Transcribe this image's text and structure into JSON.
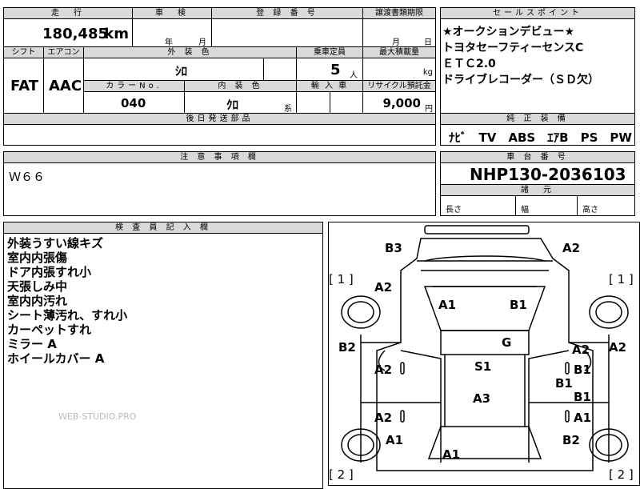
{
  "header": {
    "mileage_label": "走　行",
    "inspection_label": "車　検",
    "registration_label": "登 録 番 号",
    "transfer_label": "譲渡書類期限",
    "sale_points_label": "セールスポイント",
    "mileage_value": "180,485",
    "mileage_unit": "km",
    "year_unit": "年",
    "month_unit": "月",
    "transfer_month": "月",
    "transfer_day": "日"
  },
  "specs": {
    "shift_label": "シフト",
    "aircon_label": "エアコン",
    "exterior_label": "外 装 色",
    "capacity_label": "乗車定員",
    "max_load_label": "最大積載量",
    "shift_value": "FAT",
    "aircon_value": "AAC",
    "exterior_value": "ｼﾛ",
    "capacity_value": "5",
    "capacity_unit": "人",
    "load_unit": "kg",
    "color_no_label": "カラーNo.",
    "interior_label": "内 装 色",
    "import_label": "輸 入 車",
    "recycle_label": "リサイクル預託金",
    "color_no_value": "040",
    "interior_value": "ｸﾛ",
    "interior_suffix": "系",
    "recycle_value": "9,000",
    "recycle_unit": "円",
    "later_parts_label": "後日発送部品"
  },
  "sale_points": {
    "lines": [
      "★オークションデビュー★",
      "トヨタセーフティーセンスC",
      "ＥＴＣ2.0",
      "ドライブレコーダー（ＳＤ欠）"
    ],
    "equipment_label": "純 正 装 備",
    "equipment_value": "ﾅﾋﾞ　TV　ABS　ｴｱB　PS　PW"
  },
  "notes": {
    "label": "注 意 事 項 欄",
    "value": "Ｗ６６"
  },
  "chassis": {
    "label": "車 台 番 号",
    "value": "NHP130-2036103",
    "dimensions_label": "諸　元",
    "length_label": "長さ",
    "width_label": "幅",
    "height_label": "高さ"
  },
  "inspector": {
    "label": "検 査 員 記 入 欄",
    "lines": [
      "外装うすい線キズ",
      "室内内張傷",
      "ドア内張すれ小",
      "天張しみ中",
      "室内内汚れ",
      "シート薄汚れ、すれ小",
      "カーペットすれ",
      "ミラー A",
      "ホイールカバー A"
    ]
  },
  "watermark": "WEB-STUDIO.PRO",
  "diagram": {
    "bracket_1_left": "[ 1 ]",
    "bracket_1_right": "[ 1 ]",
    "bracket_2_left": "[ 2 ]",
    "bracket_2_right": "[ 2 ]",
    "damage_codes": [
      "B3",
      "A2",
      "A2",
      "A1",
      "B1",
      "B2",
      "G",
      "A2",
      "A2",
      "A2",
      "S1",
      "B1",
      "B1",
      "A3",
      "B1",
      "A2",
      "A1",
      "A1",
      "B2",
      "A1"
    ]
  }
}
